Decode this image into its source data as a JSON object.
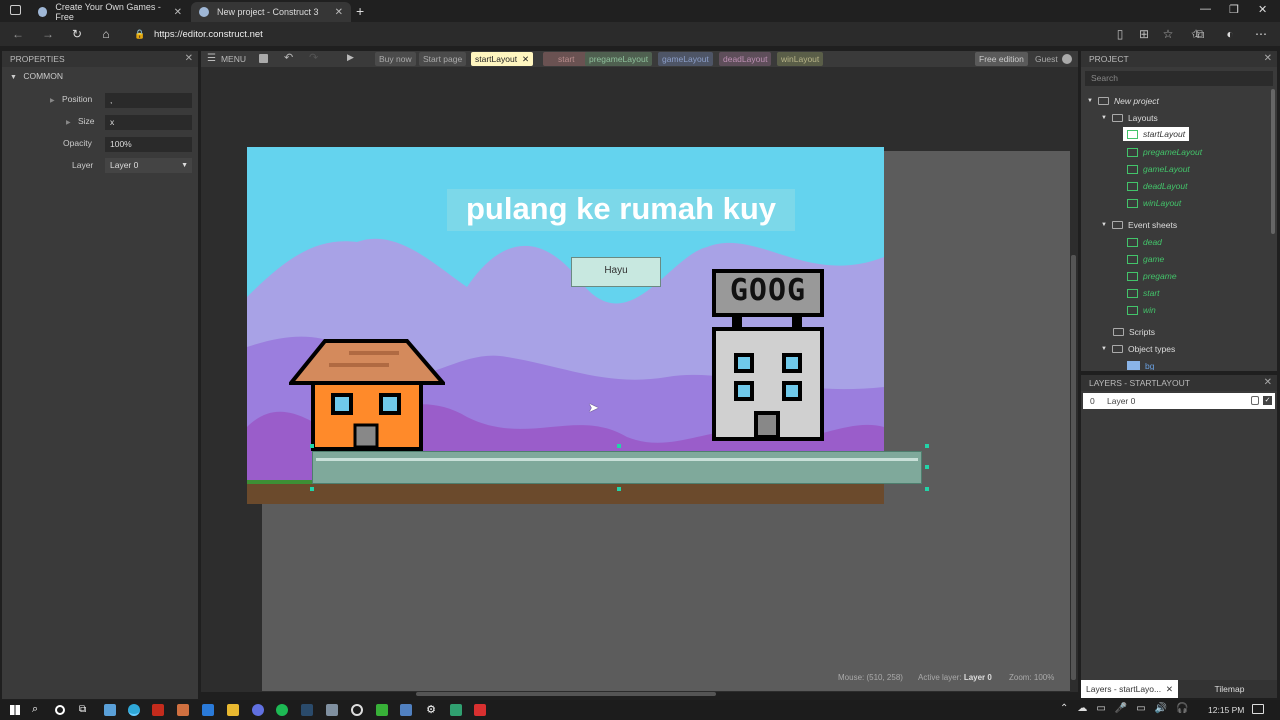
{
  "browser": {
    "tabs": [
      {
        "title": "Create Your Own Games - Free"
      },
      {
        "title": "New project - Construct 3"
      }
    ],
    "new_tab": "+",
    "url": "https://editor.construct.net"
  },
  "properties": {
    "title": "PROPERTIES",
    "section": "COMMON",
    "rows": [
      {
        "label": "Position",
        "value": ","
      },
      {
        "label": "Size",
        "value": "x"
      },
      {
        "label": "Opacity",
        "value": "100%"
      },
      {
        "label": "Layer",
        "value": "Layer 0"
      }
    ]
  },
  "toolbar": {
    "menu_label": "MENU",
    "tabs": [
      "Buy now",
      "Start page",
      "startLayout",
      "start",
      "pregameLayout",
      "gameLayout",
      "deadLayout",
      "winLayout"
    ],
    "active_tab": "startLayout",
    "edition": "Free edition",
    "user": "Guest"
  },
  "scene": {
    "title": "pulang ke rumah kuy",
    "button_label": "Hayu",
    "building_sign": "GOOG"
  },
  "status": {
    "mouse": "Mouse: (510, 258)",
    "active_layer_label": "Active layer:",
    "active_layer": "Layer 0",
    "zoom": "Zoom: 100%"
  },
  "project": {
    "title": "PROJECT",
    "search_placeholder": "Search",
    "root": "New project",
    "layouts_label": "Layouts",
    "layouts": [
      "startLayout",
      "pregameLayout",
      "gameLayout",
      "deadLayout",
      "winLayout"
    ],
    "eventsheets_label": "Event sheets",
    "eventsheets": [
      "dead",
      "game",
      "pregame",
      "start",
      "win"
    ],
    "scripts_label": "Scripts",
    "objecttypes_label": "Object types",
    "objecttypes": [
      "bg"
    ]
  },
  "layers": {
    "title": "LAYERS - STARTLAYOUT",
    "rows": [
      {
        "index": "0",
        "name": "Layer 0"
      }
    ]
  },
  "bottom_tabs": [
    "Layers - startLayo...",
    "Tilemap"
  ],
  "taskbar": {
    "time": "12:15 PM"
  },
  "colors": {
    "sky": "#64d3ee",
    "accent_green": "#43c46a",
    "house_orange": "#ff8a2a"
  }
}
